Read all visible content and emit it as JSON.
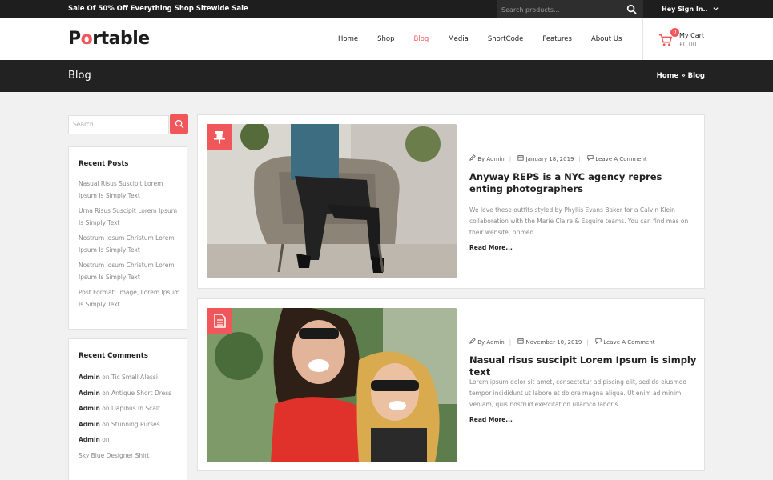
{
  "topbar": {
    "promo": "Sale Of 50% Off Everything Shop Sitewide Sale",
    "search_placeholder": "Search products...",
    "signin": "Hey Sign In..",
    "signin_icon": "chevron-down-icon"
  },
  "header": {
    "logo": {
      "p": "P",
      "o": "o",
      "rest": "rtable"
    },
    "nav": [
      "Home",
      "Shop",
      "Blog",
      "Media",
      "ShortCode",
      "Features",
      "About Us"
    ],
    "active_nav": "Blog",
    "cart": {
      "count": "0",
      "label": "My Cart",
      "price": "£0.00",
      "icon": "shopping-cart-icon"
    }
  },
  "titlebar": {
    "title": "Blog",
    "breadcrumb": {
      "home": "Home",
      "sep": " » ",
      "current": "Blog"
    }
  },
  "sidebar": {
    "search_placeholder": "Search",
    "recent_posts": {
      "title": "Recent Posts",
      "items": [
        "Nasual Risus Suscipit Lorem Ipsum Is Simply Text",
        "Urna Risus Suscipit Lorem Ipsum Is Simply Text",
        "Nostrum Iosum Christum Lorem Ipsum Is Simply Text",
        "Nostrum Iosum Christum Lorem Ipsum Is Simply Text",
        "Post Format: Image, Lorem Ipsum Is Simply Text"
      ]
    },
    "recent_comments": {
      "title": "Recent Comments",
      "on": "on",
      "items": [
        {
          "author": "Admin",
          "post": "Tic Small Alessi"
        },
        {
          "author": "Admin",
          "post": "Antique Short Dress"
        },
        {
          "author": "Admin",
          "post": "Dapibus In Scalf"
        },
        {
          "author": "Admin",
          "post": "Stunning Purses"
        },
        {
          "author": "Admin",
          "post": ""
        }
      ],
      "trailing": "Sky Blue Designer Shirt"
    }
  },
  "posts": [
    {
      "icon": "pin-icon",
      "author": "By Admin",
      "date": "January 18, 2019",
      "comments": "Leave A Comment",
      "title": "Anyway REPS is a NYC agency repres enting photographers",
      "excerpt": "We love these outfits styled by Phyllis Evans Baker for a Calvin Klein collaboration with the Marie Claire & Esquire teams. You can find mas on their website, primed .",
      "read_more": "Read More..."
    },
    {
      "icon": "document-icon",
      "author": "By Admin",
      "date": "November 10, 2019",
      "comments": "Leave A Comment",
      "title": "Nasual risus suscipit Lorem Ipsum is simply text",
      "excerpt": "Lorem ipsum dolor sit amet, consectetur adipiscing elit, sed do eiusmod tempor incididunt ut labore et dolore magna aliqua. Ut enim ad minim veniam, quis nostrud exercitation ullamco laboris .",
      "read_more": "Read More..."
    }
  ],
  "colors": {
    "accent": "#f0575b",
    "dark": "#1e1e1e"
  }
}
